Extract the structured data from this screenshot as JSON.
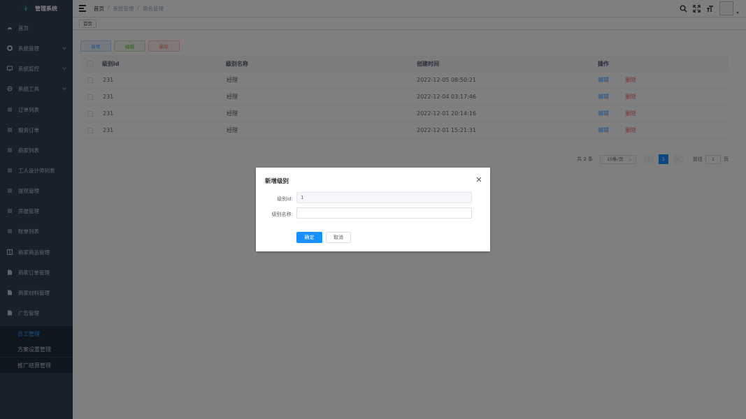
{
  "app": {
    "title": "管理系统"
  },
  "sidebar": {
    "items": [
      {
        "label": "首页",
        "icon": "dashboard-icon"
      },
      {
        "label": "系统管理",
        "icon": "gear-icon",
        "expandable": true
      },
      {
        "label": "系统监控",
        "icon": "monitor-icon",
        "expandable": true
      },
      {
        "label": "系统工具",
        "icon": "tool-icon",
        "expandable": true
      },
      {
        "label": "订单列表",
        "icon": "list-icon"
      },
      {
        "label": "服务订单",
        "icon": "list-icon"
      },
      {
        "label": "商家列表",
        "icon": "list-icon"
      },
      {
        "label": "工人设计师列表",
        "icon": "list-icon"
      },
      {
        "label": "提现管理",
        "icon": "list-icon"
      },
      {
        "label": "房屋管理",
        "icon": "list-icon"
      },
      {
        "label": "账单列表",
        "icon": "list-icon"
      },
      {
        "label": "商家商品管理",
        "icon": "book-icon"
      },
      {
        "label": "商家订单管理",
        "icon": "document-icon"
      },
      {
        "label": "商家材料管理",
        "icon": "document-icon"
      },
      {
        "label": "广告管理",
        "icon": "document-icon"
      }
    ],
    "sub_items": [
      {
        "label": "员工管理",
        "active": true
      },
      {
        "label": "方案设置管理",
        "active": false
      },
      {
        "label": "推广结算管理",
        "active": false
      }
    ]
  },
  "header": {
    "breadcrumb": [
      "首页",
      "系统管理",
      "角色管理"
    ],
    "separator": "/"
  },
  "tags": {
    "active": "首页"
  },
  "toolbar": {
    "add_label": "新增",
    "edit_label": "编辑",
    "delete_label": "删除"
  },
  "table": {
    "columns": [
      "级别id",
      "级别名称",
      "创建时间",
      "操作"
    ],
    "rows": [
      {
        "id": "231",
        "name": "经理",
        "created": "2022-12-05 08:50:21",
        "edit": "编辑",
        "delete": "删除"
      },
      {
        "id": "231",
        "name": "经理",
        "created": "2022-12-04 03:17:46",
        "edit": "编辑",
        "delete": "删除"
      },
      {
        "id": "231",
        "name": "经理",
        "created": "2022-12-01 20:14:16",
        "edit": "编辑",
        "delete": "删除"
      },
      {
        "id": "231",
        "name": "经理",
        "created": "2022-12-01 15:21:31",
        "edit": "编辑",
        "delete": "删除"
      }
    ]
  },
  "pagination": {
    "total_text": "共 2 条",
    "page_size": "10条/页",
    "prev": "‹",
    "current_page": "1",
    "next": "›",
    "goto_prefix": "前往",
    "goto_value": "1",
    "goto_suffix": "页"
  },
  "dialog": {
    "title": "新增级别",
    "fields": [
      {
        "label": "级别id:",
        "value": "1",
        "disabled": true
      },
      {
        "label": "级别名称:",
        "value": "",
        "disabled": false
      }
    ],
    "ok_label": "确定",
    "cancel_label": "取消"
  },
  "colors": {
    "sidebar_bg": "#304156",
    "submenu_bg": "#1f2d3d",
    "primary": "#1890ff",
    "danger": "#f56c6c",
    "success": "#67c23a"
  }
}
